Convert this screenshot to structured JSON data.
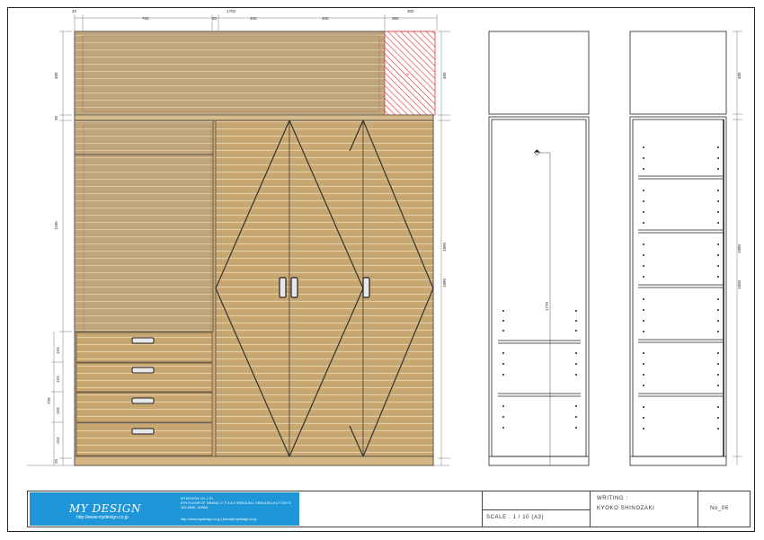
{
  "dimensions": {
    "top": [
      "20",
      "750",
      "20",
      "1700",
      "400",
      "400",
      "360",
      "300"
    ],
    "left": [
      "480",
      "30",
      "1180",
      "153",
      "153",
      "153",
      "153",
      "720",
      "20"
    ],
    "right_total": "1880",
    "side_view": "1770",
    "side_right_top": "480",
    "side_right_main": "1800"
  },
  "title_block": {
    "logo": "MY DESIGN",
    "logo_url": "http://www.mydesign.co.jp",
    "company_name": "MYDESIGN CO.,LTD.",
    "company_address": "8TH FLOOR OF GRAND 17 F 3-8-9 SHINJUKU, SHINJUKU-KU TOKYO",
    "company_city": "163-8650, JAPAN",
    "company_web": "http://www.mydesign.co.jp   |   bona@mydesign.co.jp",
    "scale": "SCALE : 1 / 10 (A3)",
    "writing_label": "WRITING :",
    "writer": "KYOKO SHINOZAKI",
    "sheet_no": "No_06"
  },
  "colors": {
    "wood": "#c9a873",
    "wood_dark": "#a5845a",
    "glass": "#bfa47d",
    "hatch": "#e23a3a",
    "logo_bg": "#1e96d8"
  }
}
